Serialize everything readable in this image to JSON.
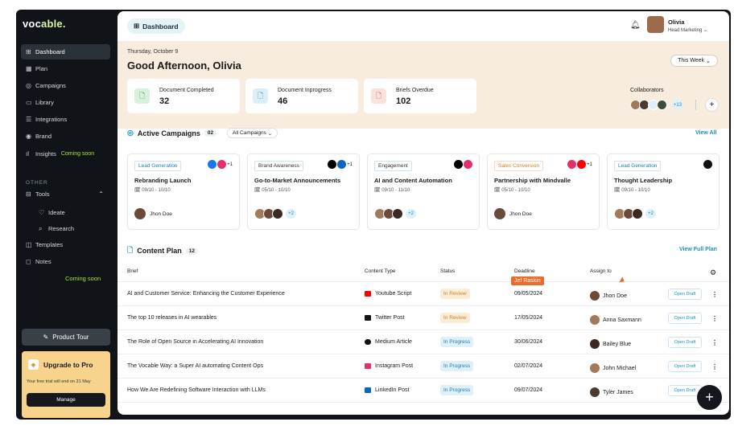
{
  "app": {
    "logo_main": "voc",
    "logo_accent": "able."
  },
  "sidebar": {
    "items": [
      {
        "label": "Dashboard",
        "icon": "grid-icon"
      },
      {
        "label": "Plan",
        "icon": "calendar-icon"
      },
      {
        "label": "Campaigns",
        "icon": "target-icon"
      },
      {
        "label": "Library",
        "icon": "folder-icon"
      },
      {
        "label": "Integrations",
        "icon": "plug-icon"
      },
      {
        "label": "Brand",
        "icon": "brand-icon"
      },
      {
        "label": "Insights",
        "icon": "chart-icon",
        "badge": "Coming soon"
      }
    ],
    "other_label": "OTHER",
    "tools_label": "Tools",
    "sub_items": [
      {
        "label": "Ideate"
      },
      {
        "label": "Research"
      }
    ],
    "templates_label": "Templates",
    "notes_label": "Notes",
    "coming_soon": "Coming soon",
    "tour_label": "Product Tour",
    "upgrade": {
      "title": "Upgrade to Pro",
      "desc": "Your free trial will end on 31 May",
      "button": "Manage"
    }
  },
  "header": {
    "page": "Dashboard",
    "user_name": "Olivia",
    "user_role": "Head Marketing"
  },
  "hero": {
    "date": "Thursday, October 9",
    "greeting": "Good Afternoon, Olivia",
    "period": "This Week",
    "stats": [
      {
        "label": "Document Completed",
        "value": "32"
      },
      {
        "label": "Document Inprogress",
        "value": "46"
      },
      {
        "label": "Briefs Overdue",
        "value": "102"
      }
    ],
    "collaborators_label": "Collaborators",
    "collaborators_more": "+13"
  },
  "campaigns": {
    "title": "Active Campaigns",
    "count": "02",
    "filter": "All Campaigns",
    "view_all": "View All",
    "cards": [
      {
        "tag": "Lead Generation",
        "title": "Rebranding Launch",
        "dates": "09/10 - 10/10",
        "owner": "Jhon Doe",
        "more": "+1"
      },
      {
        "tag": "Brand Awareness",
        "title": "Go-to-Market Announcements",
        "dates": "05/10 - 10/10",
        "more": "+2",
        "chan_more": "+1"
      },
      {
        "tag": "Engagement",
        "title": "AI and Content Automation",
        "dates": "09/10 - 11/10",
        "more": "+2"
      },
      {
        "tag": "Sales Conversion",
        "title": "Partnership with Mindvalle",
        "dates": "05/10 - 10/10",
        "owner": "Jhon Doe",
        "chan_more": "+1"
      },
      {
        "tag": "Lead Generation",
        "title": "Thought Leadership",
        "dates": "09/10 - 10/10",
        "more": "+2"
      }
    ]
  },
  "content": {
    "title": "Content Plan",
    "count": "12",
    "view_full": "View Full Plan",
    "headers": {
      "brief": "Brief",
      "type": "Content Type",
      "status": "Status",
      "deadline": "Deadline",
      "assign": "Assign to"
    },
    "tooltip": "Jef Raskin",
    "rows": [
      {
        "brief": "AI and Customer Service: Enhancing the Customer Experience",
        "type": "Youtube Script",
        "status": "In Review",
        "deadline": "09/05/2024",
        "assignee": "Jhon Doe",
        "action": "Open Draft"
      },
      {
        "brief": "The top 10 releases in AI wearables",
        "type": "Twitter Post",
        "status": "In Review",
        "deadline": "17/05/2024",
        "assignee": "Anna Saxmann",
        "action": "Open Draft"
      },
      {
        "brief": "The Role of Open Source in Accelerating AI Innovation",
        "type": "Medium Article",
        "status": "In Progress",
        "deadline": "30/06/2024",
        "assignee": "Bailey Blue",
        "action": "Open Draft"
      },
      {
        "brief": "The Vocable Way: a Super AI automating Content Ops",
        "type": "Instagram Post",
        "status": "In Progress",
        "deadline": "02/07/2024",
        "assignee": "John Michael",
        "action": "Open Draft"
      },
      {
        "brief": "How We Are Redefining Software Interaction with LLMs",
        "type": "LinkedIn Post",
        "status": "In Progress",
        "deadline": "09/07/2024",
        "assignee": "Tyler James",
        "action": "Open Draft"
      }
    ]
  },
  "colors": {
    "sidebar": "#101418",
    "accent": "#1a8fbf",
    "hero": "#f8ecde",
    "upgrade": "#f7d38b",
    "soon": "#a3e635"
  }
}
